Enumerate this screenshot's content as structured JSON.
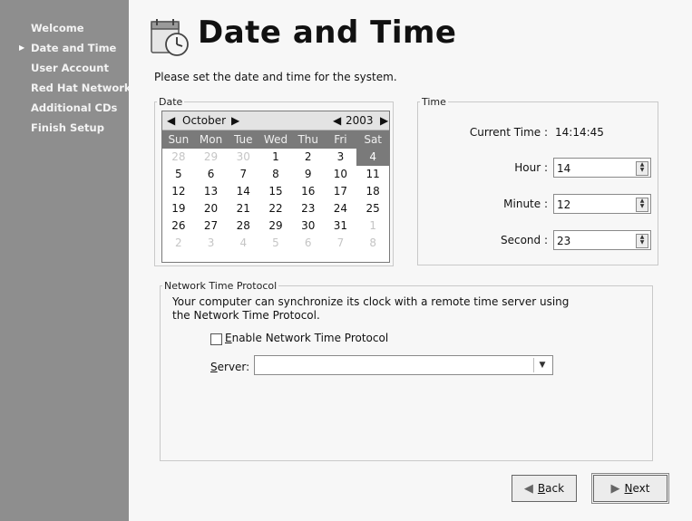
{
  "sidebar": {
    "items": [
      {
        "label": "Welcome",
        "current": false
      },
      {
        "label": "Date and Time",
        "current": true
      },
      {
        "label": "User Account",
        "current": false
      },
      {
        "label": "Red Hat Network",
        "current": false
      },
      {
        "label": "Additional CDs",
        "current": false
      },
      {
        "label": "Finish Setup",
        "current": false
      }
    ]
  },
  "page": {
    "title": "Date and Time",
    "subtitle": "Please set the date and time for the system."
  },
  "date_frame": {
    "legend": "Date",
    "month": "October",
    "year": "2003",
    "weekdays": [
      "Sun",
      "Mon",
      "Tue",
      "Wed",
      "Thu",
      "Fri",
      "Sat"
    ],
    "days": [
      "28",
      "29",
      "30",
      "1",
      "2",
      "3",
      "4",
      "5",
      "6",
      "7",
      "8",
      "9",
      "10",
      "11",
      "12",
      "13",
      "14",
      "15",
      "16",
      "17",
      "18",
      "19",
      "20",
      "21",
      "22",
      "23",
      "24",
      "25",
      "26",
      "27",
      "28",
      "29",
      "30",
      "31",
      "1",
      "2",
      "3",
      "4",
      "5",
      "6",
      "7",
      "8"
    ],
    "muted_indices": [
      0,
      1,
      2,
      34,
      35,
      36,
      37,
      38,
      39,
      40,
      41
    ],
    "selected_index": 6
  },
  "time_frame": {
    "legend": "Time",
    "current_label": "Current Time :",
    "current_value": "14:14:45",
    "hour_label": "Hour :",
    "hour_value": "14",
    "minute_label": "Minute :",
    "minute_value": "12",
    "second_label": "Second :",
    "second_value": "23"
  },
  "ntp": {
    "legend": "Network Time Protocol",
    "description": "Your computer can synchronize its clock with a remote time server using the Network Time Protocol.",
    "enable_label_first": "E",
    "enable_label_rest": "nable Network Time Protocol",
    "enabled": false,
    "server_label_first": "S",
    "server_label_rest": "erver:",
    "server_value": ""
  },
  "buttons": {
    "back_first": "B",
    "back_rest": "ack",
    "next_first": "N",
    "next_rest": "ext"
  },
  "icons": {
    "title": "calendar-clock-icon",
    "back": "triangle-left-icon",
    "next": "triangle-right-icon"
  },
  "colors": {
    "sidebar_bg": "#8e8e8e",
    "calendar_header_bg": "#7a7a7a",
    "selected_day_bg": "#7a7a7a"
  }
}
